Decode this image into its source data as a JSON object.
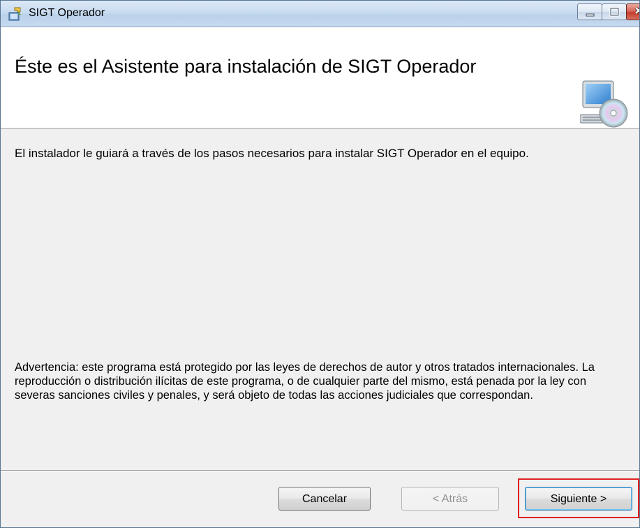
{
  "window": {
    "title": "SIGT Operador",
    "app_icon": "installer-icon"
  },
  "header": {
    "title": "Éste es el Asistente para instalación de SIGT Operador",
    "icon": "computer-cd-icon"
  },
  "body": {
    "intro": "El instalador le guiará a través de los pasos necesarios para instalar SIGT Operador en el equipo.",
    "warning": "Advertencia: este programa está protegido por las leyes de derechos de autor y otros tratados internacionales. La reproducción o distribución ilícitas de este programa, o de cualquier parte del mismo, está penada por la ley con severas sanciones civiles y penales, y será objeto de todas las acciones judiciales que correspondan."
  },
  "buttons": {
    "cancel": "Cancelar",
    "back": "< Atrás",
    "next": "Siguiente >"
  },
  "colors": {
    "highlight": "#e02020"
  }
}
